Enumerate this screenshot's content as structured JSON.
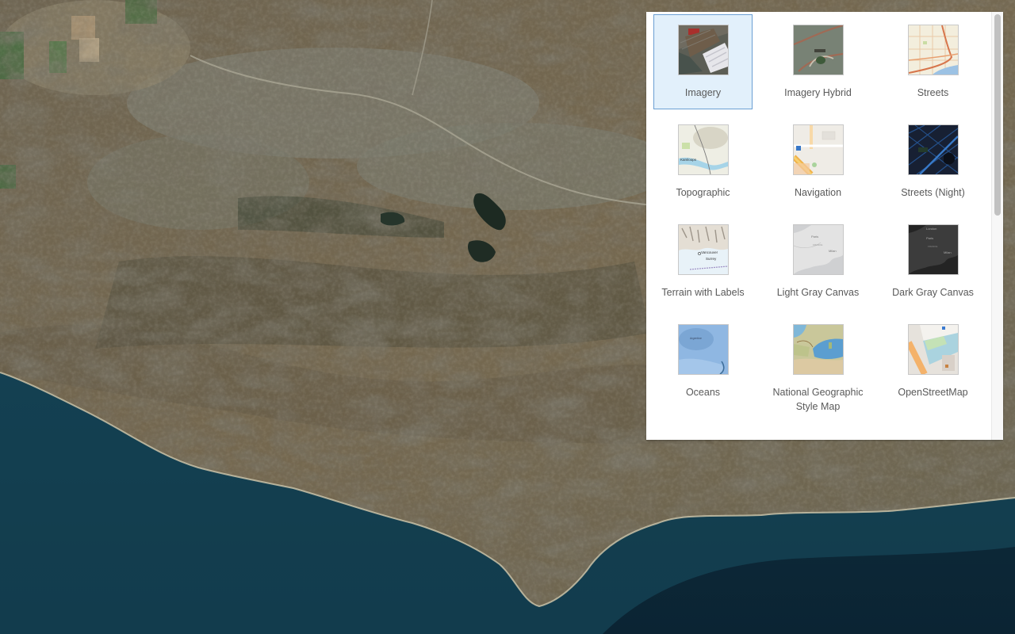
{
  "map": {
    "description": "Satellite imagery basemap of coastal mountains and ocean",
    "colors": {
      "land": "#7a6a52",
      "land_dark": "#4e4a3a",
      "vegetation": "#5e6b4a",
      "urban": "#8a8c80",
      "ocean_deep": "#0d2a3a",
      "ocean_shallow": "#1f5566",
      "beach": "#c9c2a8"
    }
  },
  "basemap_gallery": {
    "selected": "Imagery",
    "items": [
      {
        "label": "Imagery",
        "icon": "imagery-thumbnail",
        "selected": true
      },
      {
        "label": "Imagery Hybrid",
        "icon": "imagery-hybrid-thumbnail",
        "selected": false
      },
      {
        "label": "Streets",
        "icon": "streets-thumbnail",
        "selected": false
      },
      {
        "label": "Topographic",
        "icon": "topographic-thumbnail",
        "selected": false
      },
      {
        "label": "Navigation",
        "icon": "navigation-thumbnail",
        "selected": false
      },
      {
        "label": "Streets (Night)",
        "icon": "streets-night-thumbnail",
        "selected": false
      },
      {
        "label": "Terrain with Labels",
        "icon": "terrain-labels-thumbnail",
        "selected": false
      },
      {
        "label": "Light Gray Canvas",
        "icon": "light-gray-canvas-thumbnail",
        "selected": false
      },
      {
        "label": "Dark Gray Canvas",
        "icon": "dark-gray-canvas-thumbnail",
        "selected": false
      },
      {
        "label": "Oceans",
        "icon": "oceans-thumbnail",
        "selected": false
      },
      {
        "label": "National Geographic Style Map",
        "icon": "national-geographic-thumbnail",
        "selected": false
      },
      {
        "label": "OpenStreetMap",
        "icon": "openstreetmap-thumbnail",
        "selected": false
      }
    ],
    "colors": {
      "selected_bg": "#e2f0fb",
      "selected_border": "#6b9fd3",
      "label": "#595959"
    },
    "scroll": {
      "position_fraction": 0.0,
      "visible_fraction": 0.47
    }
  }
}
